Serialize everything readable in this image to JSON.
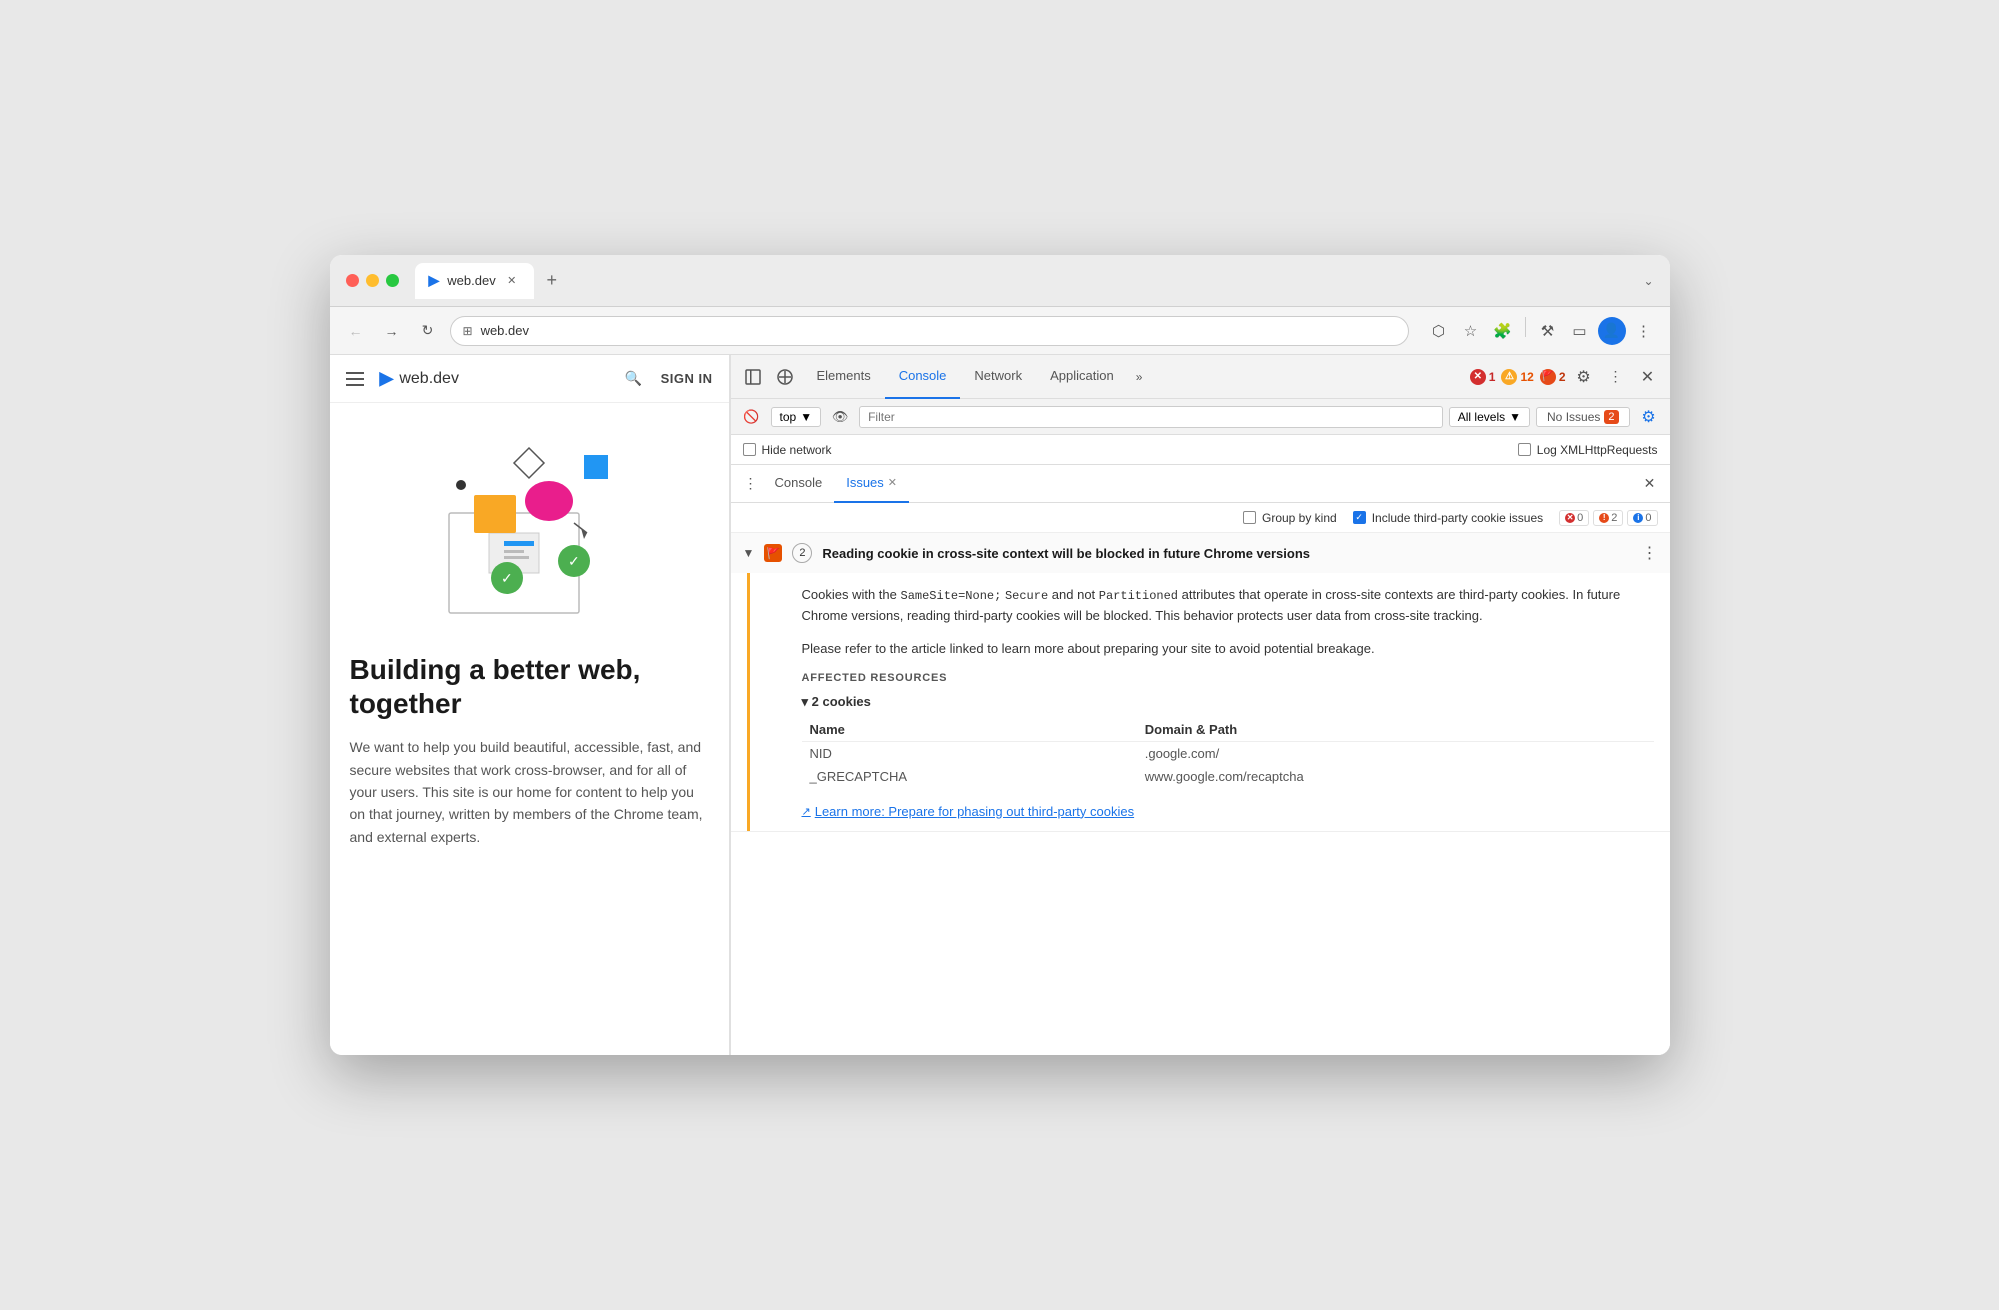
{
  "browser": {
    "tab_label": "web.dev",
    "tab_icon": "▶",
    "address": "web.dev",
    "address_icon": "⊞"
  },
  "site": {
    "logo_icon": "▶",
    "logo_text": "web.dev",
    "signin_label": "SIGN IN",
    "headline": "Building a better web, together",
    "body_text": "We want to help you build beautiful, accessible, fast, and secure websites that work cross-browser, and for all of your users. This site is our home for content to help you on that journey, written by members of the Chrome team, and external experts."
  },
  "devtools": {
    "tabs": [
      {
        "label": "Elements",
        "active": false
      },
      {
        "label": "Console",
        "active": true
      },
      {
        "label": "Network",
        "active": false
      },
      {
        "label": "Application",
        "active": false
      }
    ],
    "more_label": "»",
    "error_count": "1",
    "warning_count": "12",
    "issue_count": "2",
    "console": {
      "top_selector": "top",
      "filter_placeholder": "Filter",
      "all_levels_label": "All levels",
      "no_issues_label": "No Issues",
      "no_issues_count": "2",
      "hide_network_label": "Hide network",
      "log_xmlhttp_label": "Log XMLHttpRequests"
    },
    "issues_tabs": [
      {
        "label": "Console",
        "active": false
      },
      {
        "label": "Issues",
        "active": true
      }
    ],
    "group_by_label": "Group by kind",
    "include_label": "Include third-party cookie issues",
    "mini_badge_0": "0",
    "mini_badge_2": "2",
    "mini_badge_02": "0",
    "issue": {
      "count": "2",
      "title": "Reading cookie in cross-site context will be blocked in future Chrome versions",
      "body_p1": "Cookies with the ",
      "code1": "SameSite=None;",
      "body_p1b": " ",
      "code2": "Secure",
      "body_p1c": " and not ",
      "code3": "Partitioned",
      "body_p1d": " attributes that operate in cross-site contexts are third-party cookies. In future Chrome versions, reading third-party cookies will be blocked. This behavior protects user data from cross-site tracking.",
      "body_p2": "Please refer to the article linked to learn more about preparing your site to avoid potential breakage.",
      "affected_resources_title": "AFFECTED RESOURCES",
      "cookies_toggle": "▾ 2 cookies",
      "table_col1": "Name",
      "table_col2": "Domain & Path",
      "cookie1_name": "NID",
      "cookie1_domain": ".google.com/",
      "cookie2_name": "_GRECAPTCHA",
      "cookie2_domain": "www.google.com/recaptcha",
      "learn_more_text": "Learn more: Prepare for phasing out third-party cookies"
    }
  }
}
